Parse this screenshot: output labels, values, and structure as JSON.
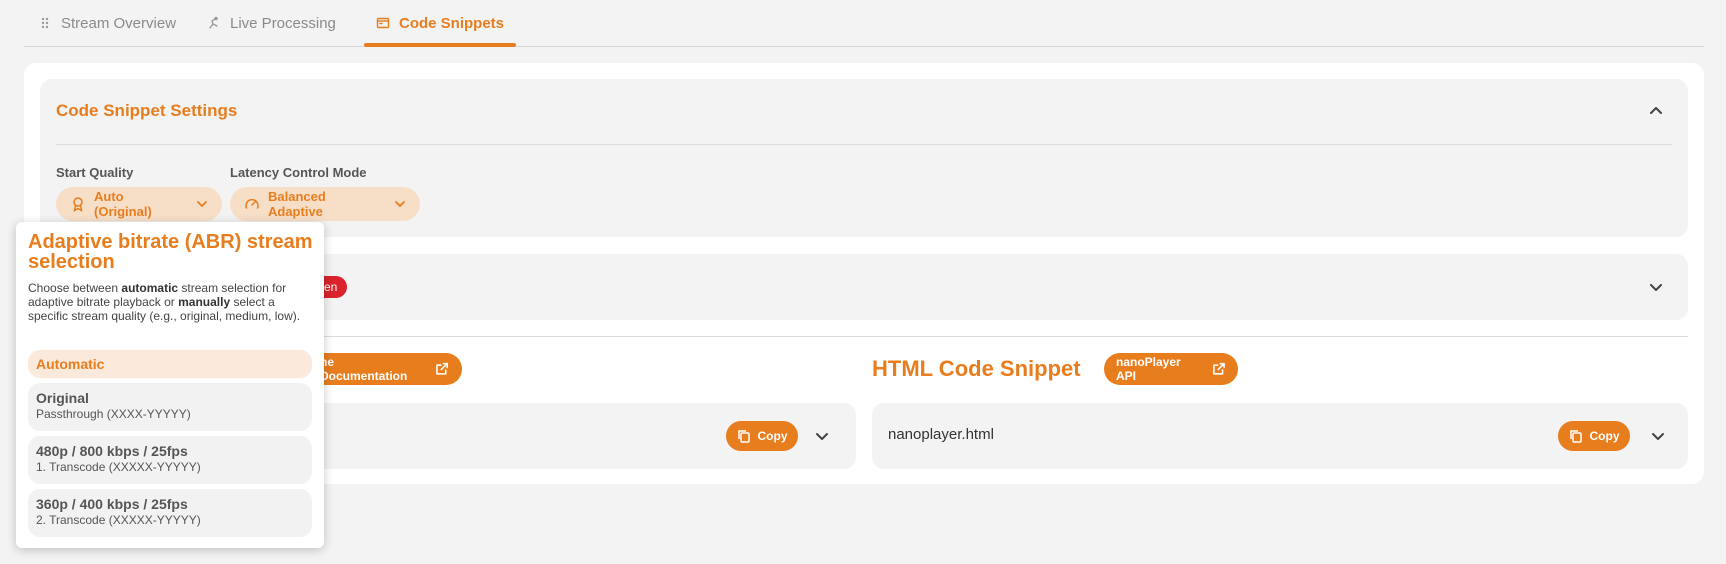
{
  "tabs": [
    {
      "label": "Stream Overview",
      "icon": "grip-dots-icon"
    },
    {
      "label": "Live Processing",
      "icon": "processing-icon"
    },
    {
      "label": "Code Snippets",
      "icon": "code-window-icon"
    }
  ],
  "settings": {
    "title": "Code Snippet Settings",
    "start_quality": {
      "label": "Start Quality",
      "value": "Auto (Original)",
      "icon": "award-icon"
    },
    "latency_mode": {
      "label": "Latency Control Mode",
      "value": "Balanced Adaptive",
      "icon": "speedometer-icon"
    }
  },
  "panel2": {
    "badge": "ken"
  },
  "snippets": {
    "left_doc_button": "ne Documentation",
    "html_title": "HTML Code Snippet",
    "api_button": "nanoPlayer API",
    "html_file": "nanoplayer.html",
    "copy_label": "Copy"
  },
  "popover": {
    "title": "Adaptive bitrate (ABR) stream selection",
    "desc_1": "Choose between ",
    "desc_b1": "automatic",
    "desc_2": " stream selection for adaptive bitrate playback or ",
    "desc_b2": "manually",
    "desc_3": " select a specific stream quality (e.g., original, medium, low).",
    "options": [
      {
        "name": "Automatic",
        "sub": ""
      },
      {
        "name": "Original",
        "sub": "Passthrough (XXXX-YYYYY)"
      },
      {
        "name": "480p / 800 kbps / 25fps",
        "sub": "1. Transcode (XXXXX-YYYYY)"
      },
      {
        "name": "360p / 400 kbps / 25fps",
        "sub": "2. Transcode (XXXXX-YYYYY)"
      }
    ]
  },
  "colors": {
    "accent": "#e87d1e",
    "accent_light": "#f7dfc7",
    "danger": "#d9232d",
    "panel": "#f3f3f3"
  }
}
